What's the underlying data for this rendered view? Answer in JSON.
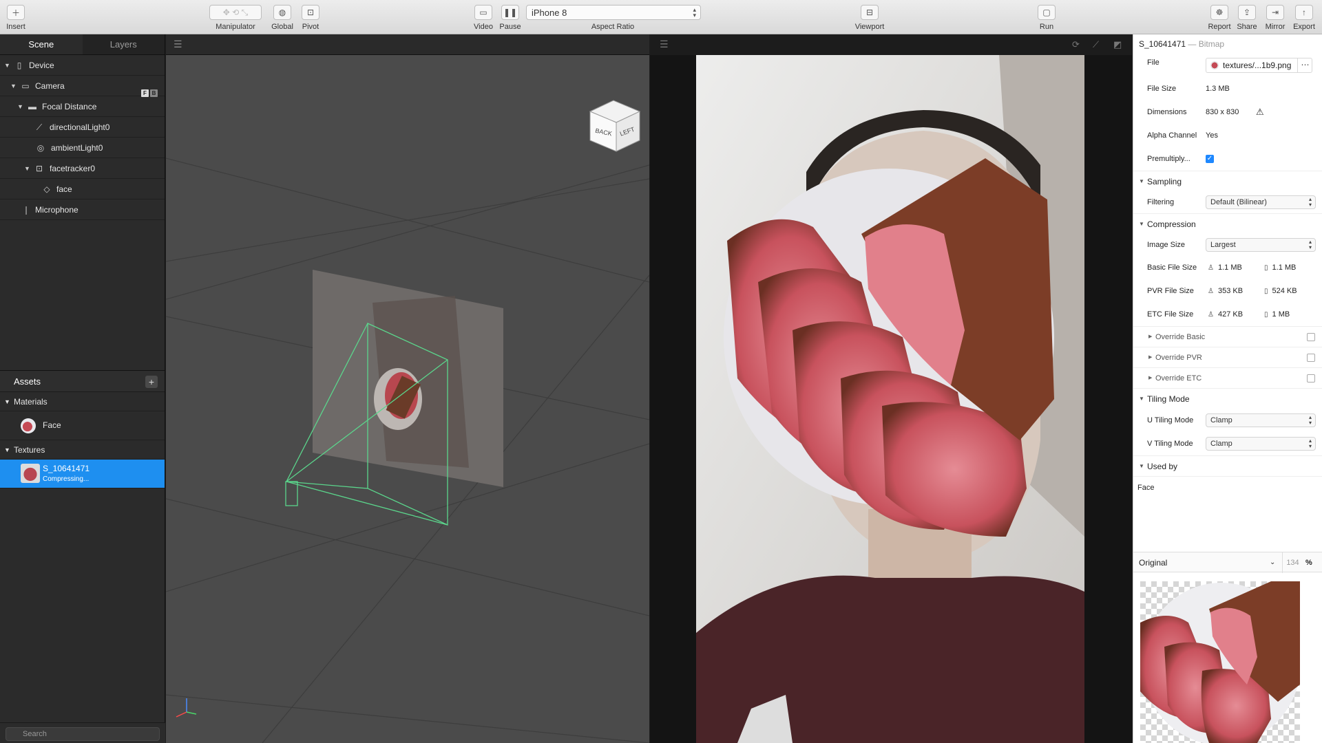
{
  "toolbar": {
    "insert": "Insert",
    "manipulator": "Manipulator",
    "global": "Global",
    "pivot": "Pivot",
    "video": "Video",
    "pause": "Pause",
    "device": "iPhone 8",
    "aspect_ratio": "Aspect Ratio",
    "viewport": "Viewport",
    "run": "Run",
    "report": "Report",
    "share": "Share",
    "mirror": "Mirror",
    "export": "Export"
  },
  "left_panel": {
    "tabs": [
      "Scene",
      "Layers"
    ],
    "scene": [
      {
        "label": "Device"
      },
      {
        "label": "Camera",
        "badges": [
          "F",
          "B"
        ]
      },
      {
        "label": "Focal Distance"
      },
      {
        "label": "directionalLight0"
      },
      {
        "label": "ambientLight0"
      },
      {
        "label": "facetracker0"
      },
      {
        "label": "face"
      },
      {
        "label": "Microphone"
      }
    ],
    "assets_title": "Assets",
    "materials_title": "Materials",
    "materials": [
      {
        "name": "Face"
      }
    ],
    "textures_title": "Textures",
    "textures": [
      {
        "name": "S_10641471",
        "status": "Compressing..."
      }
    ],
    "search_placeholder": "Search"
  },
  "viewport": {
    "cube_labels": [
      "BACK",
      "LEFT"
    ]
  },
  "inspector": {
    "title": "S_10641471",
    "type": "— Bitmap",
    "file_label": "File",
    "file_value": "textures/...1b9.png",
    "file_size_label": "File Size",
    "file_size": "1.3 MB",
    "dimensions_label": "Dimensions",
    "dimensions": "830 x 830",
    "alpha_label": "Alpha Channel",
    "alpha": "Yes",
    "premultiply_label": "Premultiply...",
    "premultiply_checked": true,
    "sampling_title": "Sampling",
    "filtering_label": "Filtering",
    "filtering": "Default (Bilinear)",
    "compression_title": "Compression",
    "image_size_label": "Image Size",
    "image_size": "Largest",
    "basic_label": "Basic File Size",
    "basic_a": "1.1 MB",
    "basic_b": "1.1 MB",
    "pvr_label": "PVR File Size",
    "pvr_a": "353 KB",
    "pvr_b": "524 KB",
    "etc_label": "ETC File Size",
    "etc_a": "427 KB",
    "etc_b": "1 MB",
    "override_basic": "Override Basic",
    "override_pvr": "Override PVR",
    "override_etc": "Override ETC",
    "tiling_title": "Tiling Mode",
    "u_label": "U Tiling Mode",
    "u_value": "Clamp",
    "v_label": "V Tiling Mode",
    "v_value": "Clamp",
    "used_by_title": "Used by",
    "used_by": "Face",
    "preview_mode": "Original",
    "preview_zoom": "134",
    "preview_pct": "%"
  }
}
